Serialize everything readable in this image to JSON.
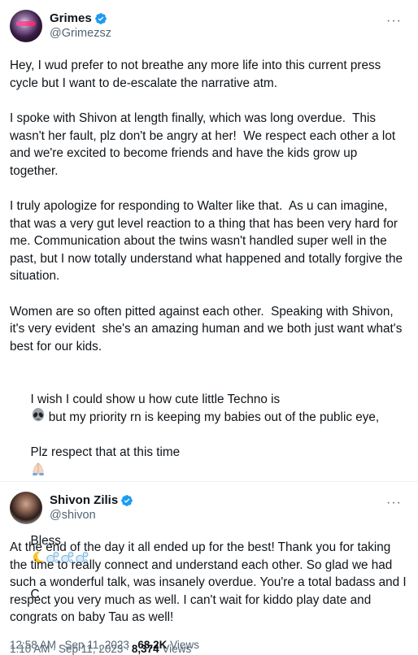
{
  "tweets": [
    {
      "display_name": "Grimes",
      "handle": "@Grimezsz",
      "paragraphs": [
        "Hey, I wud prefer to not breathe any more life into this current press cycle but I want to de-escalate the narrative atm.",
        "I spoke with Shivon at length finally, which was long overdue.  This wasn't her fault, plz don't be angry at her!  We respect each other a lot and we're excited to become friends and have the kids grow up together.",
        "I truly apologize for responding to Walter like that.  As u can imagine, that was a very gut level reaction to a thing that has been very hard for me. Communication about the twins wasn't handled super well in the past, but I now totally understand what happened and totally forgive the situation.",
        "Women are so often pitted against each other.  Speaking with Shivon, it's very evident  she's an amazing human and we both just want what's best for our kids."
      ],
      "techno_line_1": "I wish I could show u how cute little Techno is",
      "techno_line_2": " but my priority rn is keeping my babies out of the public eye,",
      "respect_line": "Plz respect that at this time",
      "bless": "Bless",
      "sign": "C",
      "time": "12:58 AM",
      "date": "Sep 11, 2023",
      "views_count": "68.2K",
      "views_label": "Views"
    },
    {
      "display_name": "Shivon Zilis",
      "handle": "@shivon",
      "paragraphs": [
        "At the end of the day it all ended up for the best! Thank you for taking the time to really connect and understand each other. So glad we had such a wonderful talk, was insanely overdue. You're a total badass and I respect you very much as well. I can't wait for kiddo play date and congrats on baby Tau as well!"
      ],
      "time": "1:10 AM",
      "date": "Sep 11, 2023",
      "views_count": "8,374",
      "views_label": "Views"
    }
  ],
  "icons": {
    "verified": "verified-badge-icon",
    "more": "more-options-icon",
    "alien": "alien-emoji",
    "praying_hands": "praying-hands-emoji",
    "moon": "crescent-moon-emoji",
    "bubbles": "bubbles-emoji"
  },
  "colors": {
    "text": "#0f1419",
    "secondary": "#536471",
    "verified": "#1d9bf0",
    "divider": "#eff3f4"
  }
}
